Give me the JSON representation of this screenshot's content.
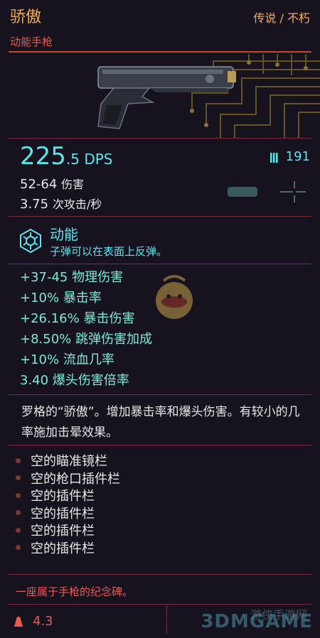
{
  "header": {
    "title": "骄傲",
    "rarity": "传说 / 不朽",
    "subtitle": "动能手枪"
  },
  "stats": {
    "dps_main": "225",
    "dps_fraction": ".5 DPS",
    "ammo": "191",
    "damage_range": "52-64",
    "damage_unit": "伤害",
    "attacks_per_sec": "3.75",
    "aps_unit": "次攻击/秒"
  },
  "power": {
    "title": "动能",
    "description": "子弹可以在表面上反弹。"
  },
  "bonuses": [
    {
      "value": "+37-45",
      "label": "物理伤害"
    },
    {
      "value": "+10%",
      "label": "暴击率"
    },
    {
      "value": "+26.16%",
      "label": "暴击伤害"
    },
    {
      "value": "+8.50%",
      "label": "跳弹伤害加成"
    },
    {
      "value": "+10%",
      "label": "流血几率"
    },
    {
      "value": "3.40",
      "label": "爆头伤害倍率"
    }
  ],
  "description": "罗格的“骄傲”。增加暴击率和爆头伤害。有较小的几率施加击晕效果。",
  "slots": [
    "空的瞄准镜栏",
    "空的枪口插件栏",
    "空的插件栏",
    "空的插件栏",
    "空的插件栏",
    "空的插件栏"
  ],
  "lore": "一座属于手枪的纪念碑。",
  "weight": "4.3",
  "watermark": "3DMGAME",
  "watermark_cn": "游侠手游网",
  "colors": {
    "accent_cyan": "#5fe3ea",
    "accent_red": "#e85a52",
    "accent_orange": "#f5ac59"
  }
}
